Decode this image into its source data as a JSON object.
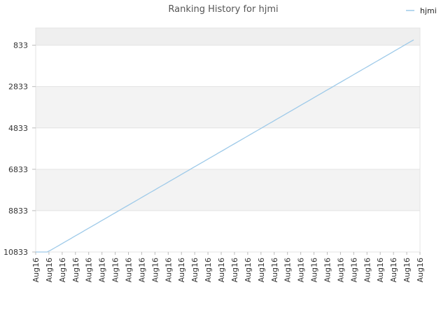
{
  "chart_data": {
    "type": "line",
    "title": "Ranking History for hjmi",
    "xlabel": "",
    "ylabel": "",
    "y_inverted": true,
    "ylim": [
      10833,
      0
    ],
    "y_ticks": [
      833,
      2833,
      4833,
      6833,
      8833,
      10833
    ],
    "x": [
      "Aug16",
      "Aug16",
      "Aug16",
      "Aug16",
      "Aug16",
      "Aug16",
      "Aug16",
      "Aug16",
      "Aug16",
      "Aug16",
      "Aug16",
      "Aug16",
      "Aug16",
      "Aug16",
      "Aug16",
      "Aug16",
      "Aug16",
      "Aug16",
      "Aug16",
      "Aug16",
      "Aug16",
      "Aug16",
      "Aug16",
      "Aug16",
      "Aug16",
      "Aug16",
      "Aug16",
      "Aug16",
      "Aug16",
      "Aug16"
    ],
    "series": [
      {
        "name": "hjmi",
        "color": "#9ecae9",
        "values": [
          10833,
          10833,
          10833,
          10833,
          10738,
          10631,
          10524,
          10417,
          10310,
          10203,
          10096,
          9989,
          9882,
          9775,
          9668,
          9561,
          9454,
          9347,
          9240,
          9133,
          9026,
          8919,
          8812,
          8705,
          8598,
          8491,
          8384,
          8277,
          8170,
          8063,
          7956,
          7849,
          7742,
          7635,
          7528,
          7421,
          7314,
          7207,
          7100,
          6993,
          6886,
          6779,
          6672,
          6565,
          6458,
          6351,
          6244,
          6137,
          6030,
          5923,
          5816,
          5709,
          5602,
          5495,
          5388,
          5281,
          5174,
          5067,
          4960,
          4853,
          4746,
          4639,
          4532,
          4425,
          4318,
          4211,
          4104,
          3997,
          3890,
          3783,
          3676,
          3569,
          3462,
          3355,
          3248,
          3141,
          3034,
          2927,
          2820,
          2713,
          2606,
          2499,
          2392,
          2285,
          2178,
          2071,
          1964,
          1857,
          1750,
          1643,
          1536,
          1429,
          1322,
          1215,
          1108,
          1001,
          894,
          787,
          680,
          573
        ]
      }
    ],
    "grid": true,
    "legend": "top-right"
  }
}
